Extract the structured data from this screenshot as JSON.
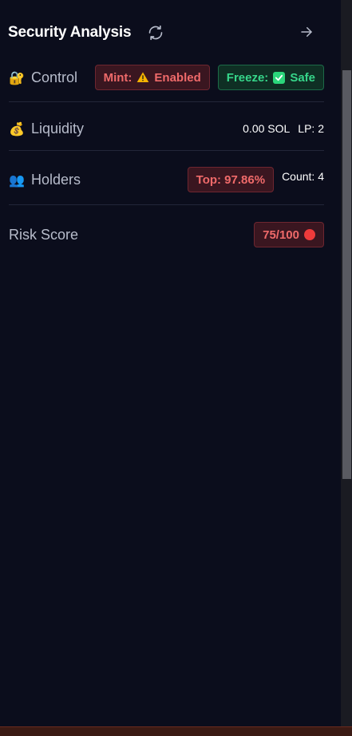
{
  "header": {
    "title": "Security Analysis",
    "refresh_icon": "refresh-icon",
    "arrow_icon": "arrow-right-icon"
  },
  "control": {
    "emoji": "🔐",
    "label": "Control",
    "mint_label": "Mint:",
    "mint_icon": "warning-icon",
    "mint_value": "Enabled",
    "freeze_label": "Freeze:",
    "freeze_icon": "checkbox-check-icon",
    "freeze_value": "Safe"
  },
  "liquidity": {
    "emoji": "💰",
    "label": "Liquidity",
    "sol": "0.00 SOL",
    "lp": "LP: 2"
  },
  "holders": {
    "emoji": "👥",
    "label": "Holders",
    "top": "Top: 97.86%",
    "count": "Count: 4"
  },
  "risk": {
    "label": "Risk Score",
    "score": "75/100",
    "status_icon": "red-circle-icon"
  },
  "colors": {
    "background": "#0b0d1c",
    "danger": "#ef6a6a",
    "success": "#36d68a",
    "divider": "#232639"
  }
}
